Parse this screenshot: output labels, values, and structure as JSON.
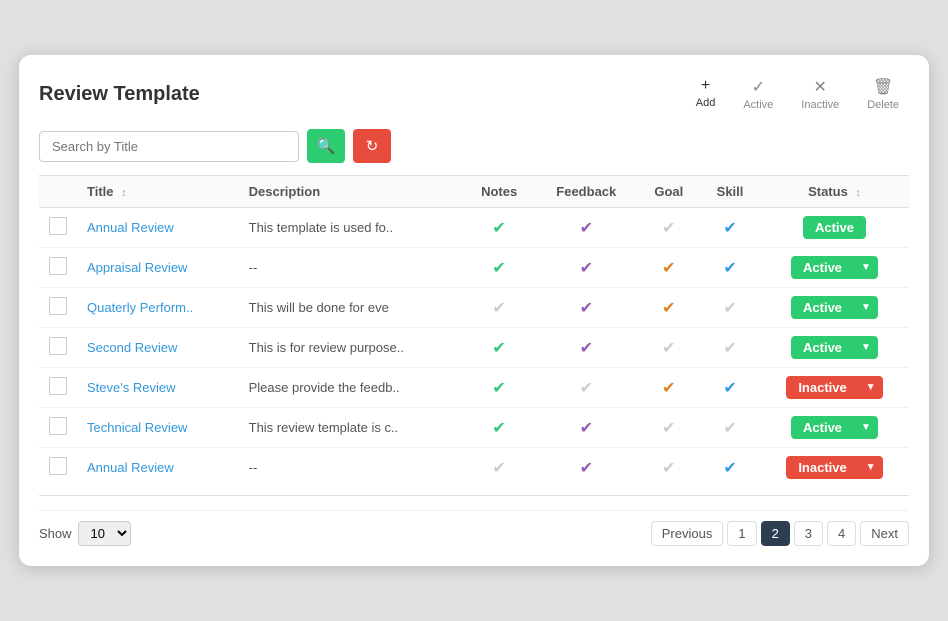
{
  "header": {
    "title": "Review Template",
    "toolbar": {
      "add_label": "Add",
      "active_label": "Active",
      "inactive_label": "Inactive",
      "delete_label": "Delete"
    }
  },
  "search": {
    "placeholder": "Search by Title"
  },
  "table": {
    "columns": [
      "",
      "Title",
      "Description",
      "Notes",
      "Feedback",
      "Goal",
      "Skill",
      "Status"
    ],
    "rows": [
      {
        "title": "Annual Review",
        "description": "This template is used fo..",
        "notes": "green",
        "feedback": "purple",
        "goal": "gray",
        "skill": "blue",
        "status": "active",
        "status_label": "Active",
        "first": true
      },
      {
        "title": "Appraisal Review",
        "description": "--",
        "notes": "green",
        "feedback": "purple",
        "goal": "orange",
        "skill": "blue",
        "status": "active",
        "status_label": "Active"
      },
      {
        "title": "Quaterly Perform..",
        "description": "This will be done for eve",
        "notes": "gray",
        "feedback": "purple",
        "goal": "orange",
        "skill": "gray",
        "status": "active",
        "status_label": "Active"
      },
      {
        "title": "Second Review",
        "description": "This is for review purpose..",
        "notes": "green",
        "feedback": "purple",
        "goal": "gray",
        "skill": "gray",
        "status": "active",
        "status_label": "Active"
      },
      {
        "title": "Steve's Review",
        "description": "Please provide the feedb..",
        "notes": "green",
        "feedback": "gray",
        "goal": "orange",
        "skill": "blue",
        "status": "inactive",
        "status_label": "Inactive"
      },
      {
        "title": "Technical Review",
        "description": "This review template is c..",
        "notes": "green",
        "feedback": "purple",
        "goal": "gray",
        "skill": "gray",
        "status": "active",
        "status_label": "Active"
      },
      {
        "title": "Annual Review",
        "description": "--",
        "notes": "gray",
        "feedback": "purple",
        "goal": "gray",
        "skill": "blue",
        "status": "inactive",
        "status_label": "Inactive"
      }
    ]
  },
  "pagination": {
    "show_label": "Show",
    "show_value": "10",
    "prev_label": "Previous",
    "next_label": "Next",
    "pages": [
      "1",
      "2",
      "3",
      "4"
    ],
    "active_page": "2"
  }
}
